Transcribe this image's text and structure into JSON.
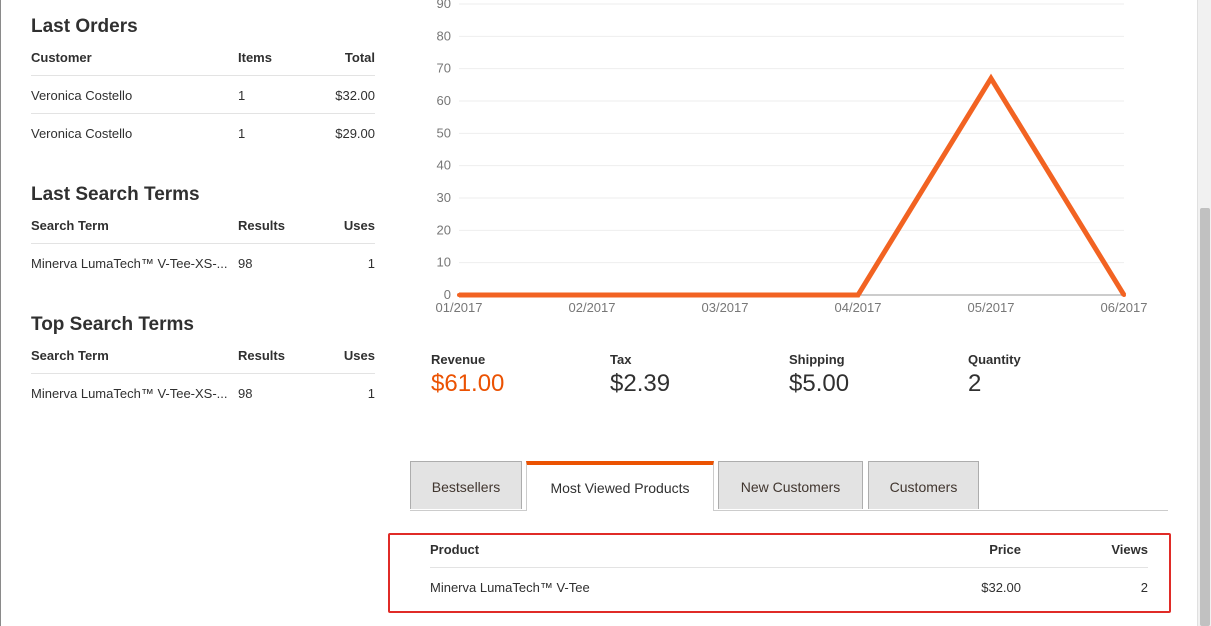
{
  "last_orders": {
    "title": "Last Orders",
    "headers": {
      "customer": "Customer",
      "items": "Items",
      "total": "Total"
    },
    "rows": [
      {
        "customer": "Veronica Costello",
        "items": "1",
        "total": "$32.00"
      },
      {
        "customer": "Veronica Costello",
        "items": "1",
        "total": "$29.00"
      }
    ]
  },
  "last_search_terms": {
    "title": "Last Search Terms",
    "headers": {
      "term": "Search Term",
      "results": "Results",
      "uses": "Uses"
    },
    "rows": [
      {
        "term": "Minerva LumaTech™ V-Tee-XS-...",
        "results": "98",
        "uses": "1"
      }
    ]
  },
  "top_search_terms": {
    "title": "Top Search Terms",
    "headers": {
      "term": "Search Term",
      "results": "Results",
      "uses": "Uses"
    },
    "rows": [
      {
        "term": "Minerva LumaTech™ V-Tee-XS-...",
        "results": "98",
        "uses": "1"
      }
    ]
  },
  "chart_data": {
    "type": "line",
    "x": [
      "01/2017",
      "02/2017",
      "03/2017",
      "04/2017",
      "05/2017",
      "06/2017"
    ],
    "series": [
      {
        "values": [
          0,
          0,
          0,
          0,
          67,
          0
        ],
        "color": "#f26322"
      }
    ],
    "ylim": [
      0,
      90
    ],
    "yticks": [
      0,
      10,
      20,
      30,
      40,
      50,
      60,
      70,
      80,
      90
    ],
    "grid": true
  },
  "totals": {
    "revenue": {
      "label": "Revenue",
      "value": "$61.00"
    },
    "tax": {
      "label": "Tax",
      "value": "$2.39"
    },
    "shipping": {
      "label": "Shipping",
      "value": "$5.00"
    },
    "quantity": {
      "label": "Quantity",
      "value": "2"
    }
  },
  "tabs": [
    {
      "label": "Bestsellers",
      "active": false
    },
    {
      "label": "Most Viewed Products",
      "active": true
    },
    {
      "label": "New Customers",
      "active": false
    },
    {
      "label": "Customers",
      "active": false
    }
  ],
  "most_viewed": {
    "headers": {
      "product": "Product",
      "price": "Price",
      "views": "Views"
    },
    "rows": [
      {
        "product": "Minerva LumaTech™ V-Tee",
        "price": "$32.00",
        "views": "2"
      }
    ]
  },
  "colors": {
    "accent": "#eb5202",
    "chart_line": "#f26322",
    "highlight_border": "#e02b27"
  }
}
